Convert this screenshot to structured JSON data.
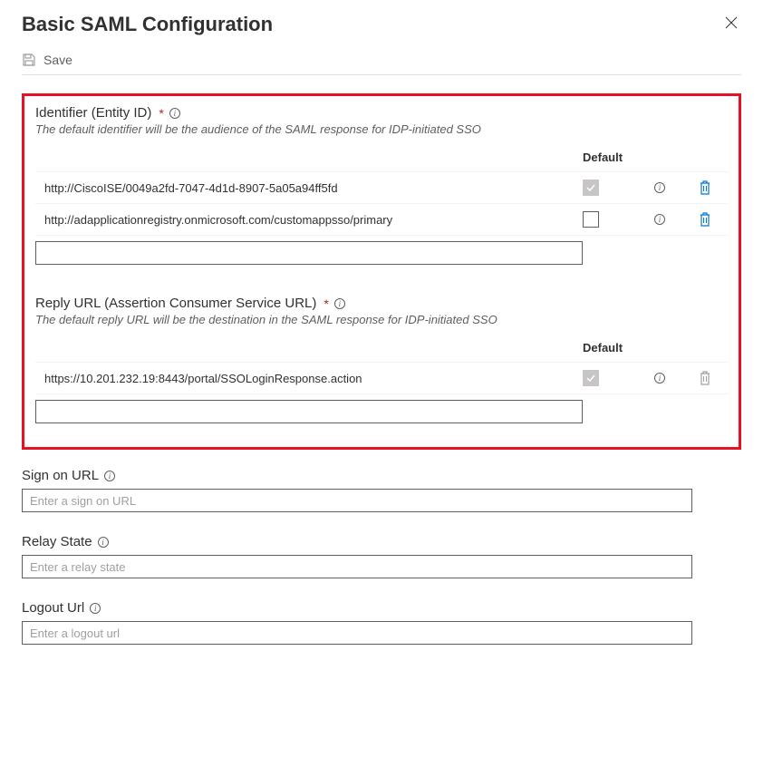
{
  "header": {
    "title": "Basic SAML Configuration"
  },
  "toolbar": {
    "save_label": "Save"
  },
  "identifier_section": {
    "label": "Identifier (Entity ID)",
    "description": "The default identifier will be the audience of the SAML response for IDP-initiated SSO",
    "default_header": "Default",
    "rows": [
      {
        "value": "http://CiscoISE/0049a2fd-7047-4d1d-8907-5a05a94ff5fd",
        "default_checked": true,
        "deletable": true
      },
      {
        "value": "http://adapplicationregistry.onmicrosoft.com/customappsso/primary",
        "default_checked": false,
        "deletable": true
      }
    ]
  },
  "reply_url_section": {
    "label": "Reply URL (Assertion Consumer Service URL)",
    "description": "The default reply URL will be the destination in the SAML response for IDP-initiated SSO",
    "default_header": "Default",
    "rows": [
      {
        "value": "https://10.201.232.19:8443/portal/SSOLoginResponse.action",
        "default_checked": true,
        "deletable": false
      }
    ]
  },
  "sign_on_url": {
    "label": "Sign on URL",
    "placeholder": "Enter a sign on URL"
  },
  "relay_state": {
    "label": "Relay State",
    "placeholder": "Enter a relay state"
  },
  "logout_url": {
    "label": "Logout Url",
    "placeholder": "Enter a logout url"
  }
}
